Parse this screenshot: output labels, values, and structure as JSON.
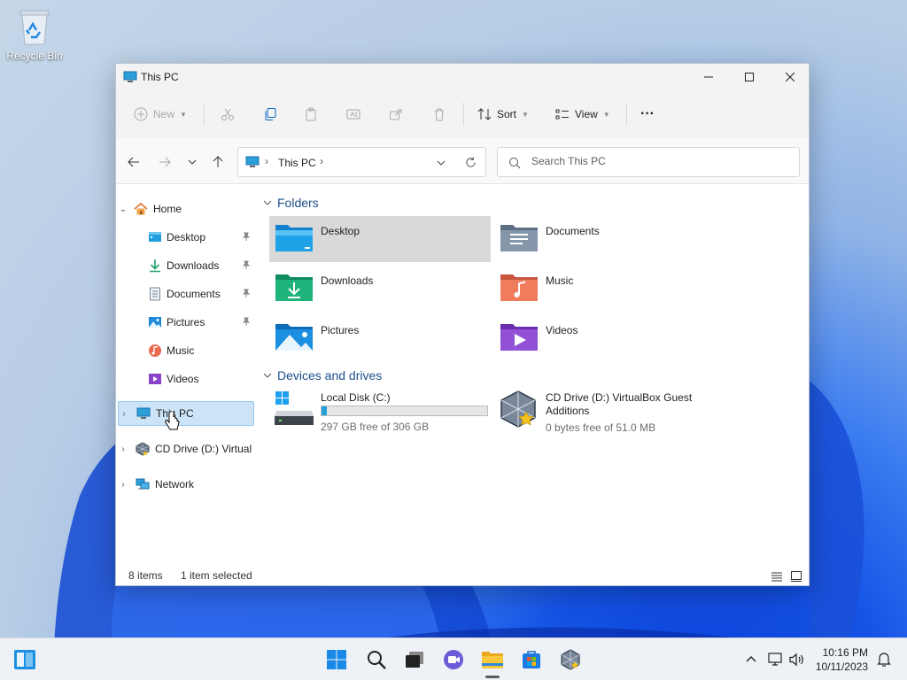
{
  "desktop": {
    "recycle_bin_label": "Recycle Bin"
  },
  "window": {
    "title": "This PC",
    "controls": {
      "minimize": "minimize-icon",
      "maximize": "maximize-icon",
      "close": "close-icon"
    }
  },
  "toolbar": {
    "new_label": "New",
    "sort_label": "Sort",
    "view_label": "View",
    "more_label": "···"
  },
  "navbar": {
    "address_text": "This PC",
    "search_placeholder": "Search This PC"
  },
  "sidebar": {
    "home": "Home",
    "items": [
      {
        "label": "Desktop",
        "pinned": true
      },
      {
        "label": "Downloads",
        "pinned": true
      },
      {
        "label": "Documents",
        "pinned": true
      },
      {
        "label": "Pictures",
        "pinned": true
      },
      {
        "label": "Music",
        "pinned": false
      },
      {
        "label": "Videos",
        "pinned": false
      }
    ],
    "this_pc": "This PC",
    "cd_drive": "CD Drive (D:) Virtual",
    "network": "Network"
  },
  "content": {
    "folders_heading": "Folders",
    "folders": [
      {
        "name": "Desktop",
        "selected": true
      },
      {
        "name": "Documents"
      },
      {
        "name": "Downloads"
      },
      {
        "name": "Music"
      },
      {
        "name": "Pictures"
      },
      {
        "name": "Videos"
      }
    ],
    "drives_heading": "Devices and drives",
    "drives": [
      {
        "name": "Local Disk (C:)",
        "free_text": "297 GB free of 306 GB",
        "used_fraction": 0.03
      },
      {
        "name": "CD Drive (D:) VirtualBox Guest Additions",
        "free_text": "0 bytes free of 51.0 MB"
      }
    ]
  },
  "status": {
    "items": "8 items",
    "selected": "1 item selected"
  },
  "taskbar": {
    "time": "10:16 PM",
    "date": "10/11/2023"
  },
  "colors": {
    "accent": "#0067c0",
    "selection": "#cce4f7",
    "drive_bar": "#26a0da"
  }
}
